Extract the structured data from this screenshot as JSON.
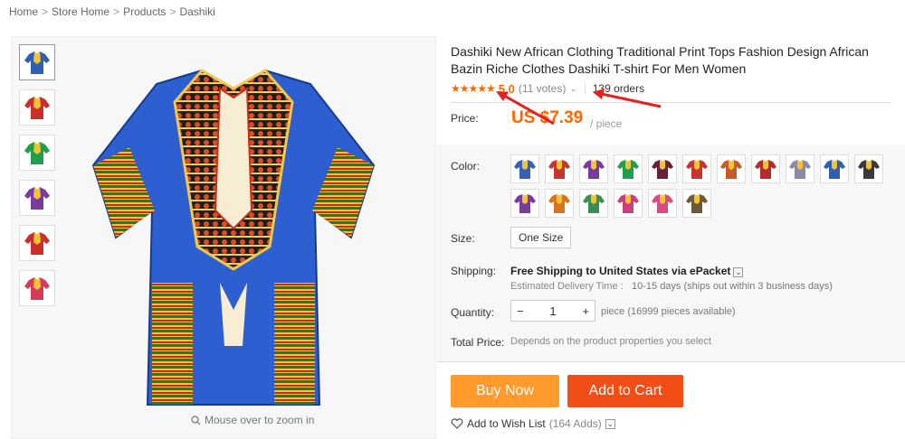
{
  "breadcrumb": [
    "Home",
    "Store Home",
    "Products",
    "Dashiki"
  ],
  "gallery": {
    "thumbs": [
      "#2f5fb5",
      "#c9302c",
      "#1f9e4c",
      "#7b3aa0",
      "#c9302c",
      "#d63a5d"
    ],
    "zoom_hint": "Mouse over to zoom in"
  },
  "product": {
    "title": "Dashiki New African Clothing Traditional Print Tops Fashion Design African Bazin Riche Clothes Dashiki T-shirt For Men Women",
    "stars": "★★★★★",
    "score": "5.0",
    "votes": "(11 votes)",
    "orders": "139 orders",
    "price_label": "Price:",
    "price": "US $7.39",
    "per": "/ piece"
  },
  "options": {
    "color_label": "Color:",
    "color_swatches": [
      "#3562b8",
      "#c8352e",
      "#7b3aa0",
      "#1f9e4c",
      "#6b1e37",
      "#c8352e",
      "#c95b2b",
      "#b52b2b",
      "#8c88a8",
      "#2f5fb5",
      "#3a3a3a",
      "#7b3aa0",
      "#d9751f",
      "#3a8c58",
      "#c93e7d",
      "#d94b87",
      "#6d5a3a"
    ],
    "size_label": "Size:",
    "size_value": "One Size",
    "shipping_label": "Shipping:",
    "shipping_main": "Free Shipping to United States via ePacket",
    "delivery_label": "Estimated Delivery Time :",
    "delivery_value": "10-15 days (ships out within 3 business days)",
    "quantity_label": "Quantity:",
    "quantity_value": "1",
    "quantity_note": "piece (16999 pieces available)",
    "total_label": "Total Price:",
    "total_note": "Depends on the product properties you select"
  },
  "actions": {
    "buy_now": "Buy Now",
    "add_to_cart": "Add to Cart",
    "wish_label": "Add to Wish List",
    "wish_count": "(164 Adds)"
  }
}
